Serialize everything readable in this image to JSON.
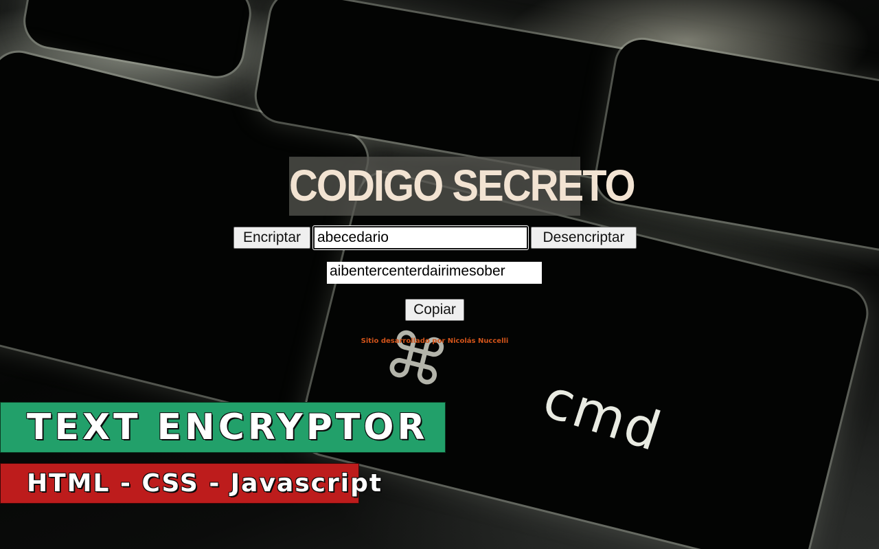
{
  "app": {
    "title": "CODIGO SECRETO",
    "encrypt_label": "Encriptar",
    "decrypt_label": "Desencriptar",
    "input_value": "abecedario",
    "output_value": "aibentercenterdairimesober",
    "copy_label": "Copiar",
    "credit": "Sitio desarrollado por Nicolás Nuccelli"
  },
  "background": {
    "key_label": "cmd",
    "key_symbol": "⌘"
  },
  "overlay": {
    "title": "TEXT ENCRYPTOR",
    "tech": "HTML - CSS - Javascript"
  },
  "colors": {
    "title_banner": "#22a06a",
    "tech_banner": "#bd1c1c",
    "credit_text": "#d2541a",
    "heading_text": "#f2e3d2"
  }
}
